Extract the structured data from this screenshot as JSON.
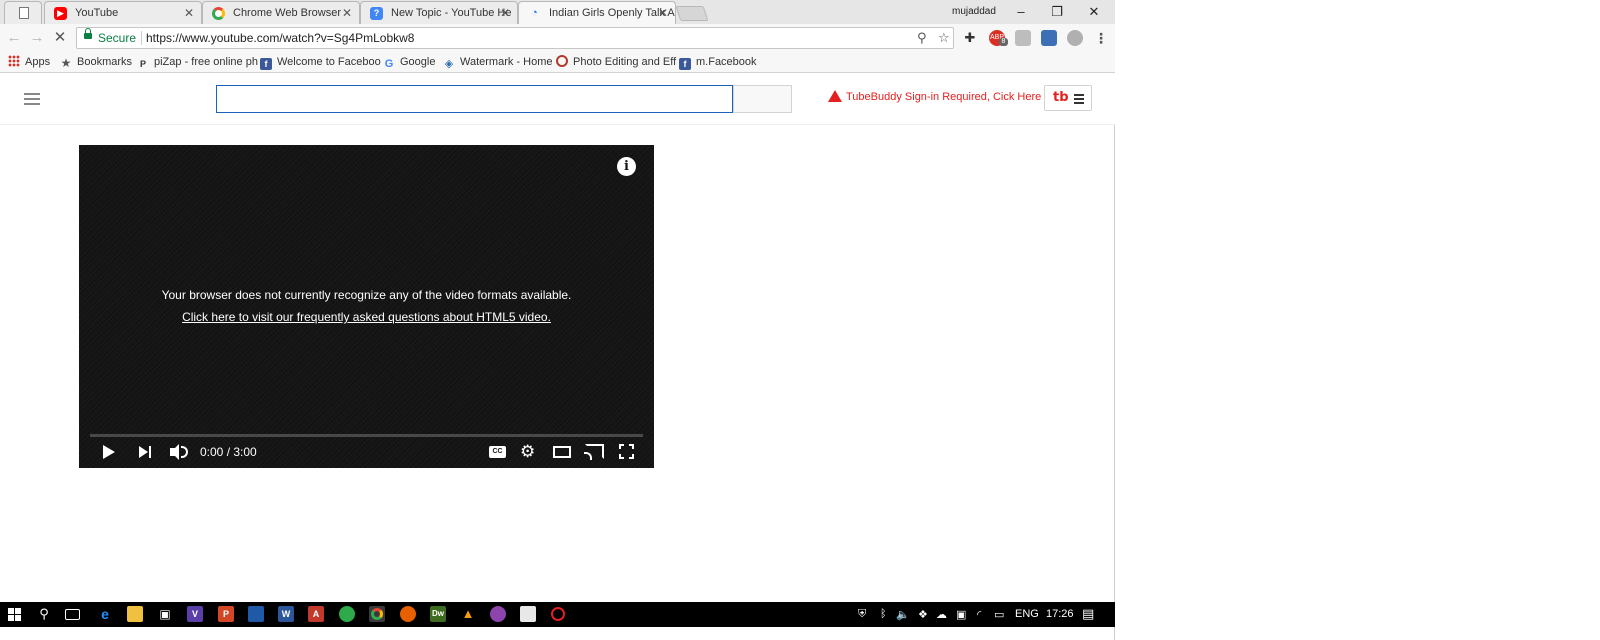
{
  "colors": {
    "accent": "#1c62b9",
    "secure_green": "#0b8043",
    "tubebuddy_red": "#e52020",
    "youtube_red": "#ff0000"
  },
  "tabs": [
    {
      "label": "YouTube",
      "icon": "youtube-icon"
    },
    {
      "label": "Chrome Web Browser",
      "icon": "google-icon"
    },
    {
      "label": "New Topic - YouTube He",
      "icon": "help-icon"
    },
    {
      "label": "Indian Girls Openly Talk A",
      "icon": "loading-icon",
      "active": true
    }
  ],
  "window": {
    "user": "mujaddad",
    "minimize": "–",
    "restore": "❐",
    "close": "✕"
  },
  "toolbar": {
    "secure_label": "Secure",
    "url": "https://www.youtube.com/watch?v=Sg4PmLobkw8",
    "ext_badge": "8"
  },
  "bookmarks": [
    {
      "label": "Apps",
      "icon": "apps-grid-icon"
    },
    {
      "label": "Bookmarks",
      "icon": "star-icon"
    },
    {
      "label": "piZap - free online ph",
      "icon": "pizap-icon"
    },
    {
      "label": "Welcome to Faceboo",
      "icon": "facebook-icon"
    },
    {
      "label": "Google",
      "icon": "google-icon"
    },
    {
      "label": "Watermark - Home",
      "icon": "watermark-icon"
    },
    {
      "label": "Photo Editing and Eff",
      "icon": "photo-edit-icon"
    },
    {
      "label": "m.Facebook",
      "icon": "facebook-icon"
    }
  ],
  "youtube": {
    "search_value": "",
    "tubebuddy_warning": "TubeBuddy Sign-in Required, Cick Here",
    "tubebuddy_logo": "tb"
  },
  "player": {
    "error_message": "Your browser does not currently recognize any of the video formats available.",
    "error_link": "Click here to visit our frequently asked questions about HTML5 video.",
    "time": "0:00 / 3:00",
    "progress": 0
  },
  "taskbar": {
    "lang": "ENG",
    "clock": "17:26"
  }
}
